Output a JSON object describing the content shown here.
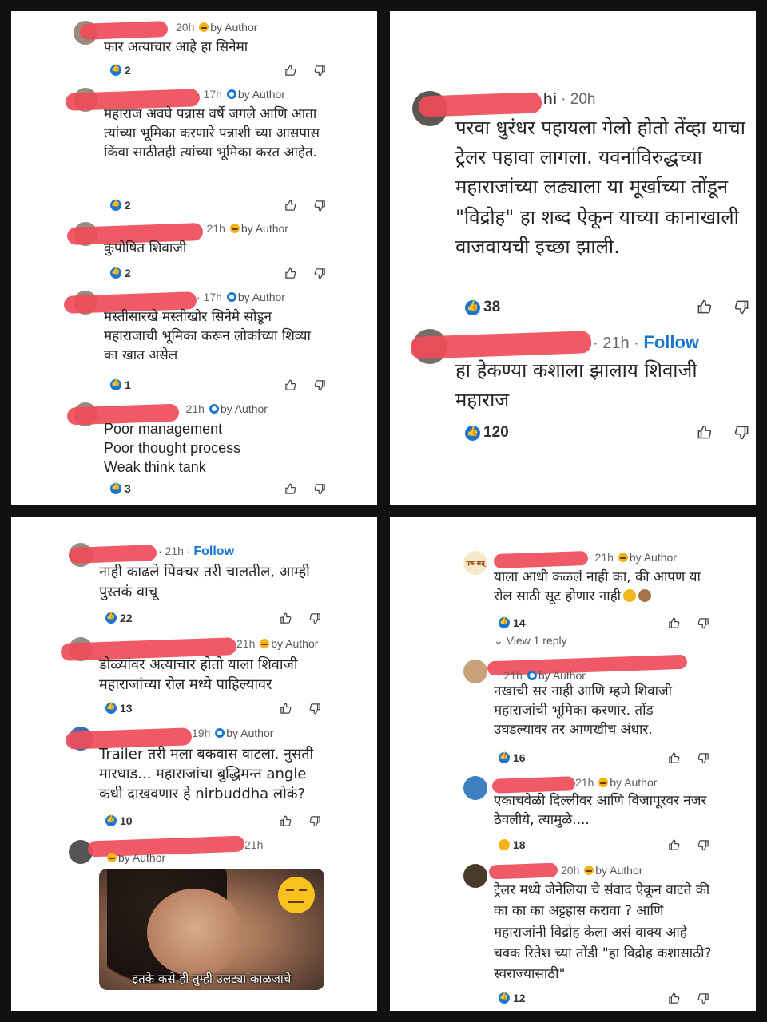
{
  "panel1": {
    "comments": [
      {
        "time": "20h",
        "author_badge": "by Author",
        "text": "फार अत्याचार आहे हा सिनेमा",
        "likes": "2"
      },
      {
        "time": "· 17h",
        "author_badge": "by Author",
        "text": "महाराज अवघे पन्नास वर्षे जगले आणि आता त्यांच्या भूमिका करणारे पन्नाशी च्या आसपास किंवा साठीतही त्यांच्या भूमिका करत आहेत.",
        "likes": "2"
      },
      {
        "time": "· 21h",
        "author_badge": "by Author",
        "text": "कुपोषित शिवाजी",
        "likes": "2"
      },
      {
        "time": "· 17h",
        "author_badge": "by Author",
        "text": "मस्तीसारखे मस्तीखोर सिनेमे सोडून महाराजाची भूमिका करून लोकांच्या शिव्या का खात असेल",
        "likes": "1"
      },
      {
        "time": "· 21h",
        "author_badge": "by Author",
        "text": "Poor management\nPoor thought process\nWeak think tank",
        "likes": "3"
      }
    ]
  },
  "panel2": {
    "comments": [
      {
        "name_tail": "hi",
        "time": "· 20h",
        "text": "परवा धुरंधर पहायला गेलो होतो तेंव्हा याचा ट्रेलर पहावा लागला. यवनांविरुद्धच्या महाराजांच्या लढ्याला या मूर्खाच्या तोंडून \"विद्रोह\"  हा शब्द ऐकून याच्या कानाखाली वाजवायची इच्छा झाली.",
        "likes": "38"
      },
      {
        "time": "· 21h ·",
        "follow": "Follow",
        "text": "हा हेकण्या कशाला झालाय शिवाजी महाराज",
        "likes": "120"
      }
    ]
  },
  "panel3": {
    "comments": [
      {
        "time": "· 21h ·",
        "follow": "Follow",
        "text": "नाही काढले पिक्चर तरी चालतील, आम्ही पुस्तकं वाचू",
        "likes": "22"
      },
      {
        "time": "21h",
        "author_badge": "by Author",
        "text": "डोळ्यांवर अत्याचार होतो याला शिवाजी महाराजांच्या रोल मध्ये पाहिल्यावर",
        "likes": "13"
      },
      {
        "time": "19h",
        "author_badge": "by Author",
        "text": "Trailer तरी मला बकवास वाटला. नुसती मारधाड... महाराजांचा बुद्धिमन्त angle कधी दाखवणार हे nirbuddha लोकं?",
        "likes": "10"
      },
      {
        "time": "21h",
        "author_badge": "by Author",
        "meme_caption": "इतके कसे ही तुम्ही उलट्या काळजाचे"
      }
    ]
  },
  "panel4": {
    "avatar_text": "एक सत्",
    "view_reply": "View 1 reply",
    "comments": [
      {
        "time": "· 21h",
        "author_badge": "by Author",
        "text": "याला आधी कळलं नाही का, की आपण या रोल साठी सूट होणार नाही",
        "likes": "14"
      },
      {
        "time": "· 21h",
        "author_badge": "by Author",
        "text": "नखाची सर नाही आणि म्हणे शिवाजी महाराजांची भूमिका करणार.  तोंड उघडल्यावर तर आणखीच अंधार.",
        "likes": "16"
      },
      {
        "time": "21h",
        "author_badge": "by Author",
        "text": "एकाचवेळी दिल्लीवर आणि विजापूरवर नजर ठेवलीये, त्यामुळे....",
        "likes": "18"
      },
      {
        "time": "20h",
        "author_badge": "by Author",
        "text": "ट्रेलर मध्ये जेनेलिया चे संवाद ऐकून वाटते की का का का अट्टहास करावा ? आणि महाराजांनी विद्रोह केला असं वाक्य आहे चक्क रितेश च्या तोंडी \"हा विद्रोह कशासाठी? स्वराज्यासाठी\"",
        "likes": "12"
      }
    ]
  },
  "colors": {
    "accent": "#1976d2",
    "redaction": "#ef4c59",
    "reaction_laugh": "#f2b41b"
  }
}
